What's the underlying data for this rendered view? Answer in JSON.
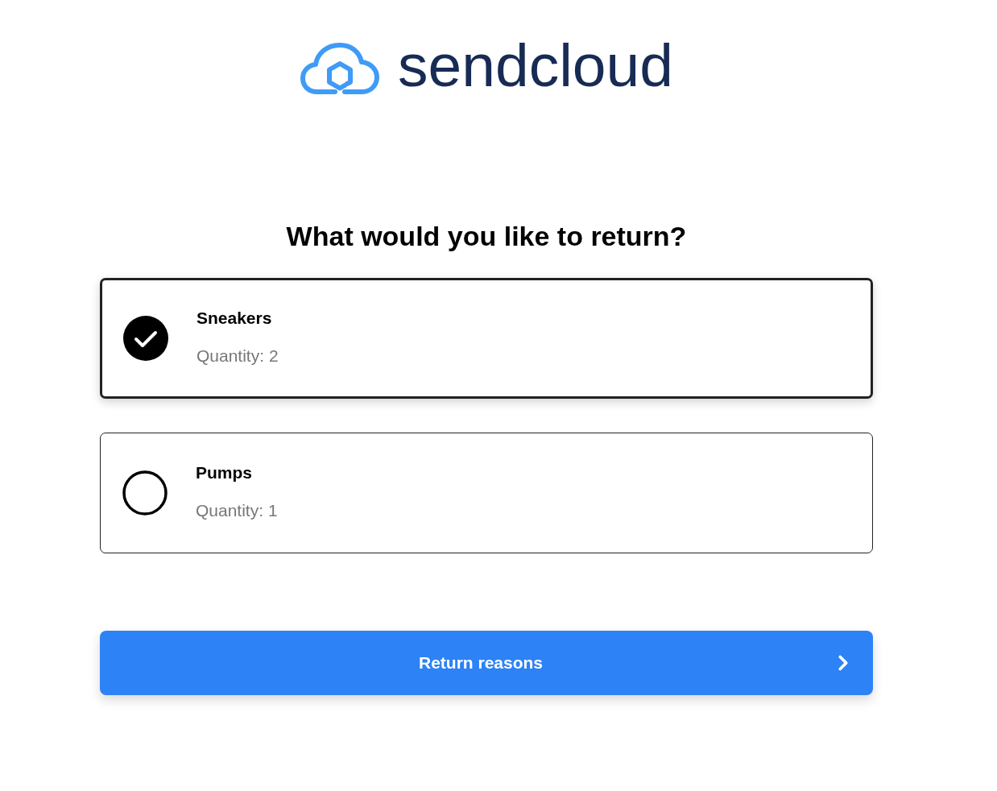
{
  "logo": {
    "text": "sendcloud"
  },
  "heading": "What would you like to return?",
  "items": [
    {
      "name": "Sneakers",
      "quantity": "Quantity: 2",
      "selected": true
    },
    {
      "name": "Pumps",
      "quantity": "Quantity: 1",
      "selected": false
    }
  ],
  "button": {
    "label": "Return reasons"
  }
}
